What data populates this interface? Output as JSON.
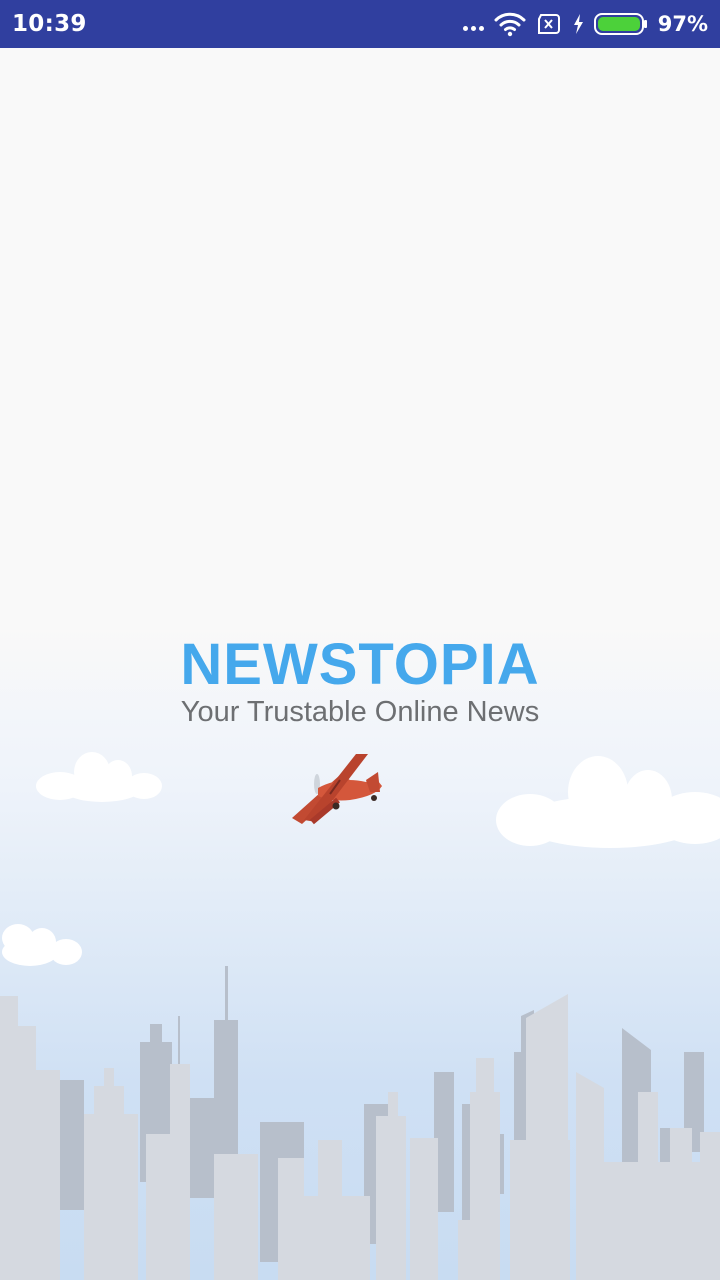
{
  "status_bar": {
    "time": "10:39",
    "battery_percent": "97%",
    "icons": [
      "more-icon",
      "wifi-icon",
      "sim-off-icon",
      "charging-icon",
      "battery-icon"
    ],
    "background_color": "#303f9f"
  },
  "splash": {
    "app_name": "NEWSTOPIA",
    "tagline": "Your Trustable Online News",
    "title_color": "#45a8ec",
    "tagline_color": "#6d6f72",
    "illustration": [
      "airplane-icon",
      "cloud-icon",
      "city-skyline"
    ]
  }
}
